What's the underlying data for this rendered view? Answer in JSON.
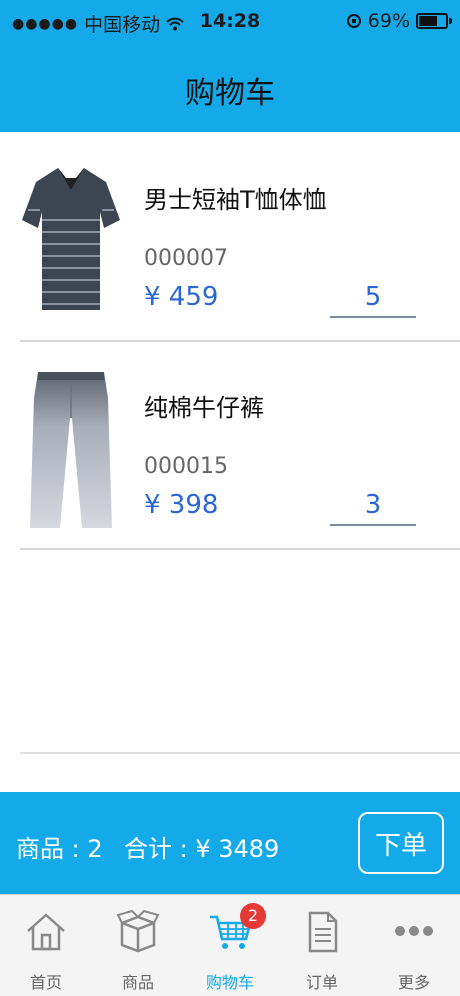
{
  "statusbar": {
    "carrier": "中国移动",
    "time": "14:28",
    "battery_label": "69%",
    "battery_level": 0.69
  },
  "header": {
    "title": "购物车"
  },
  "items": [
    {
      "name": "男士短袖T恤体恤",
      "code": "000007",
      "price": "¥ 459",
      "qty": "5"
    },
    {
      "name": "纯棉牛仔裤",
      "code": "000015",
      "price": "¥ 398",
      "qty": "3"
    }
  ],
  "summary": {
    "count": "商品 : 2",
    "total": "合计 : ¥ 3489",
    "order_label": "下单"
  },
  "tabs": [
    {
      "label": "首页",
      "icon": "home-icon"
    },
    {
      "label": "商品",
      "icon": "box-icon"
    },
    {
      "label": "购物车",
      "icon": "cart-icon",
      "badge": "2"
    },
    {
      "label": "订单",
      "icon": "document-icon"
    },
    {
      "label": "更多",
      "icon": "more-icon"
    }
  ],
  "colors": {
    "accent": "#14aaea",
    "price": "#2a66d6",
    "badge": "#e53935"
  }
}
